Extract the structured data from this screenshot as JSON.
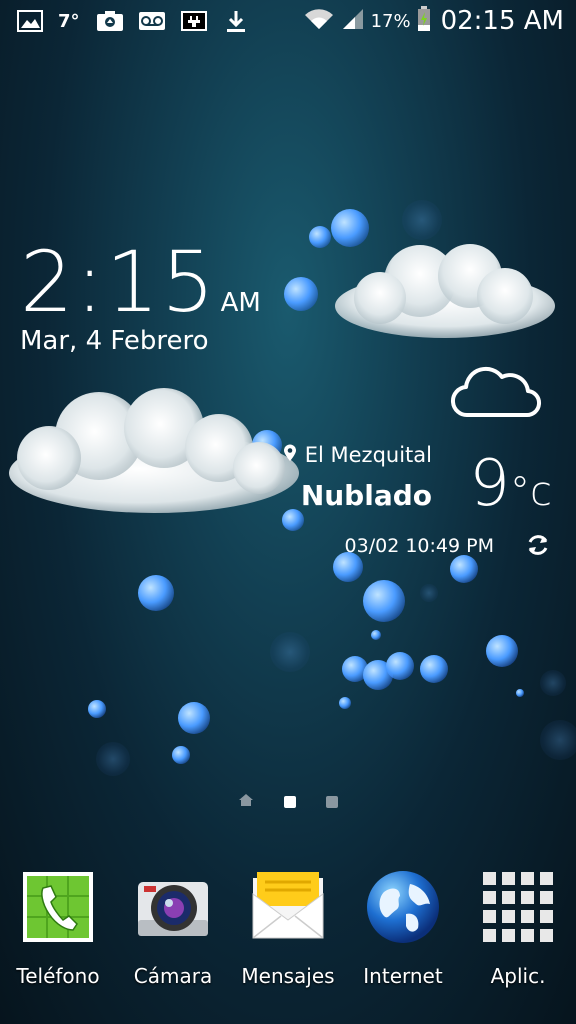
{
  "status_bar": {
    "icons_left": [
      "gallery-icon",
      "weather-temp",
      "camera-upload-icon",
      "voicemail-icon",
      "usb-charging-icon",
      "download-icon"
    ],
    "temperature": "7°",
    "battery_percent": "17%",
    "time": "02:15 AM"
  },
  "clock": {
    "time": "2:15",
    "ampm": "AM",
    "date": "Mar, 4 Febrero"
  },
  "weather": {
    "location": "El Mezquital",
    "condition": "Nublado",
    "temperature": "9",
    "unit": "°c",
    "updated": "03/02 10:49 PM"
  },
  "pages": {
    "count": 3,
    "active_index": 1
  },
  "dock": {
    "apps": [
      {
        "label": "Teléfono",
        "icon": "phone-icon"
      },
      {
        "label": "Cámara",
        "icon": "camera-icon"
      },
      {
        "label": "Mensajes",
        "icon": "messages-icon"
      },
      {
        "label": "Internet",
        "icon": "internet-globe-icon"
      },
      {
        "label": "Aplic.",
        "icon": "apps-grid-icon"
      }
    ]
  }
}
